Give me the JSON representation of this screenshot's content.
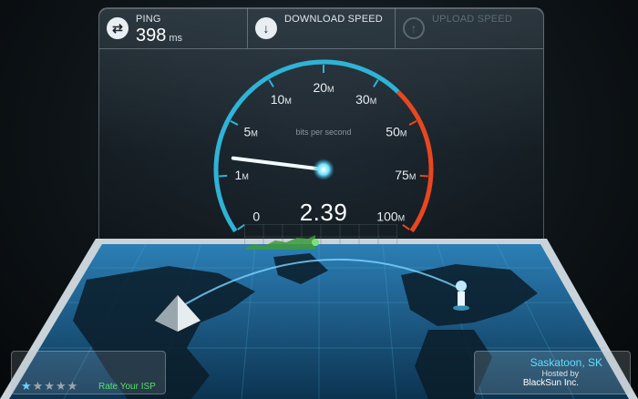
{
  "tabs": {
    "ping": {
      "title": "PING",
      "value": "398",
      "unit": "ms",
      "icon": "swap-arrows-icon"
    },
    "download": {
      "title": "DOWNLOAD SPEED",
      "icon": "arrow-down-icon"
    },
    "upload": {
      "title": "UPLOAD SPEED",
      "icon": "arrow-up-icon"
    }
  },
  "gauge": {
    "caption": "bits per second",
    "reading": "2.39",
    "needle_value_mbps": 2.39,
    "labels": [
      {
        "text": "0"
      },
      {
        "text": "1",
        "unit": "M"
      },
      {
        "text": "5",
        "unit": "M"
      },
      {
        "text": "10",
        "unit": "M"
      },
      {
        "text": "20",
        "unit": "M"
      },
      {
        "text": "30",
        "unit": "M"
      },
      {
        "text": "50",
        "unit": "M"
      },
      {
        "text": "75",
        "unit": "M"
      },
      {
        "text": "100",
        "unit": "M"
      }
    ]
  },
  "rating": {
    "label": "Rate Your ISP",
    "stars_filled": 1,
    "stars_total": 5
  },
  "server": {
    "city": "Saskatoon, SK",
    "hosted_label": "Hosted by",
    "host": "BlackSun Inc."
  },
  "colors": {
    "accent": "#2fb3d6",
    "warn": "#e8471f",
    "rating": "#52e06a"
  }
}
